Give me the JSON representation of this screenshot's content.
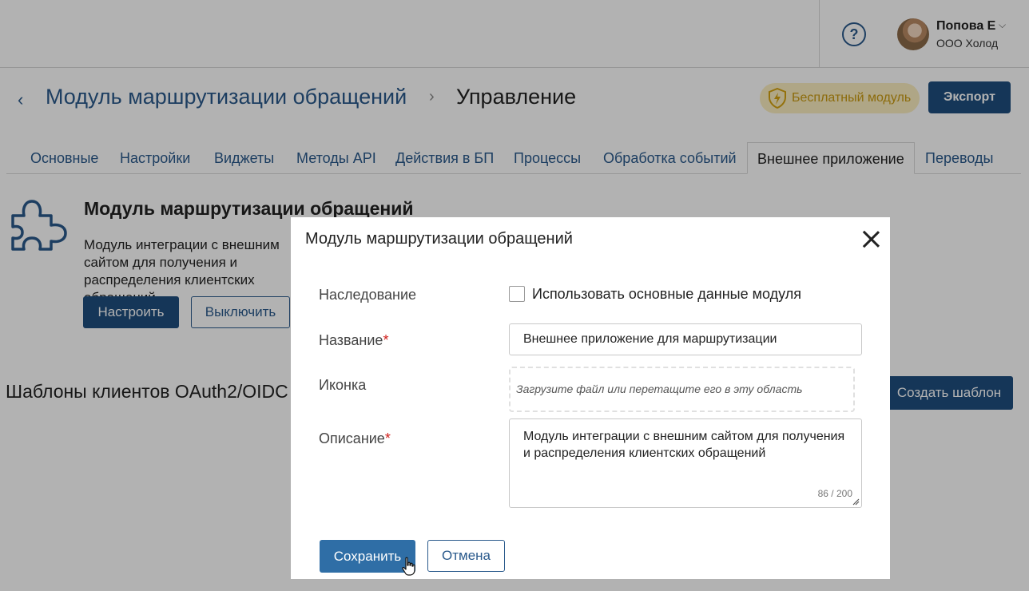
{
  "header": {
    "help_icon": "question-icon",
    "help_glyph": "?",
    "user_name": "Попова Е",
    "user_company": "ООО Холод",
    "user_menu_icon": "chevron-down-icon",
    "user_menu_glyph": "⌵"
  },
  "breadcrumb": {
    "back_glyph": "‹",
    "module": "Модуль маршрутизации обращений",
    "separator": "›",
    "current": "Управление"
  },
  "actions": {
    "free_badge": "Бесплатный модуль",
    "export": "Экспорт"
  },
  "tabs": [
    {
      "label": "Основные",
      "active": false
    },
    {
      "label": "Настройки",
      "active": false
    },
    {
      "label": "Виджеты",
      "active": false
    },
    {
      "label": "Методы API",
      "active": false
    },
    {
      "label": "Действия в БП",
      "active": false
    },
    {
      "label": "Процессы",
      "active": false
    },
    {
      "label": "Обработка событий",
      "active": false
    },
    {
      "label": "Внешнее приложение",
      "active": true
    },
    {
      "label": "Переводы",
      "active": false
    }
  ],
  "module_card": {
    "title": "Модуль маршрутизации обращений",
    "description": "Модуль интеграции с внешним сайтом для получения и распределения клиентских обращений .",
    "configure": "Настроить",
    "disable": "Выключить"
  },
  "oauth": {
    "heading": "Шаблоны клиентов OAuth2/OIDC",
    "create": "Создать шаблон"
  },
  "modal": {
    "title": "Модуль маршрутизации обращений",
    "inheritance_label": "Наследование",
    "inheritance_checkbox_label": "Использовать основные данные модуля",
    "inheritance_checked": false,
    "name_label": "Название",
    "required_mark": "*",
    "name_value": "Внешнее приложение для маршрутизации",
    "icon_label": "Иконка",
    "dropzone_text": "Загрузите файл или перетащите его в эту область",
    "description_label": "Описание",
    "description_value": "Модуль интеграции с внешним сайтом для получения и распределения клиентских обращений",
    "char_counter": "86 / 200",
    "save": "Сохранить",
    "cancel": "Отмена"
  },
  "colors": {
    "primary": "#1f4e7e",
    "save_button": "#2f6ea6",
    "link": "#2a5a8c",
    "badge_bg": "#fbeec0",
    "badge_text": "#c99a10",
    "required": "#d0201c"
  }
}
